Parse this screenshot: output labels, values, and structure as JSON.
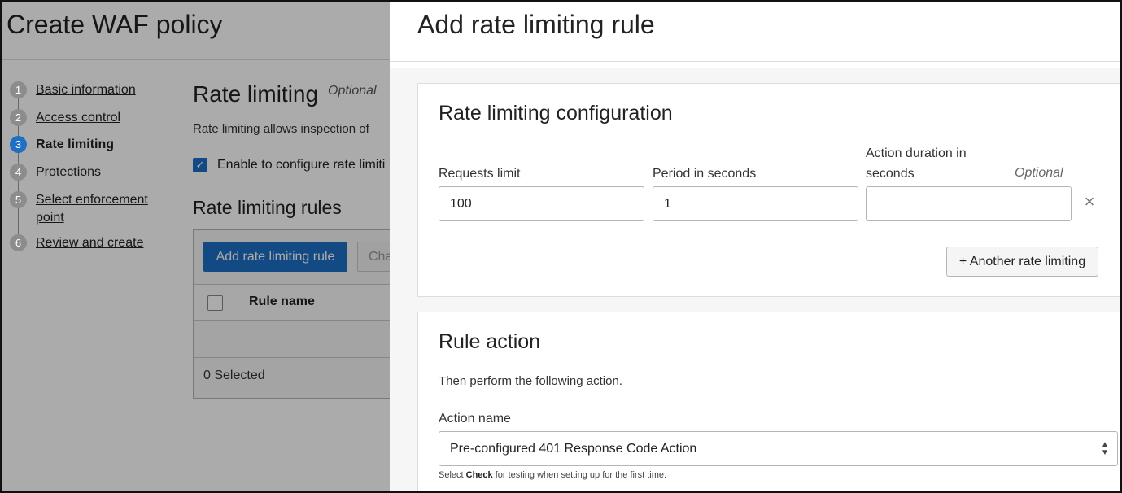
{
  "background_page": {
    "title": "Create WAF policy",
    "steps": [
      {
        "number": "1",
        "label": "Basic information",
        "active": false
      },
      {
        "number": "2",
        "label": "Access control",
        "active": false
      },
      {
        "number": "3",
        "label": "Rate limiting",
        "active": true
      },
      {
        "number": "4",
        "label": "Protections",
        "active": false
      },
      {
        "number": "5",
        "label": "Select enforcement",
        "label_line2": "point",
        "active": false
      },
      {
        "number": "6",
        "label": "Review and create",
        "active": false
      }
    ],
    "section": {
      "title": "Rate limiting",
      "optional_label": "Optional",
      "description": "Rate limiting allows inspection of",
      "enable_checkbox_label": "Enable to configure rate limiti",
      "enable_checked": true,
      "rules_title": "Rate limiting rules",
      "add_button_label": "Add rate limiting rule",
      "change_button_label": "Cha",
      "table": {
        "columns": [
          "Rule name"
        ],
        "selected_count_text": "0 Selected"
      }
    }
  },
  "panel": {
    "title": "Add rate limiting rule",
    "config_card": {
      "title": "Rate limiting configuration",
      "fields": {
        "requests_limit": {
          "label": "Requests limit",
          "value": "100"
        },
        "period": {
          "label": "Period in seconds",
          "value": "1"
        },
        "action_duration": {
          "label_line1": "Action duration in",
          "label_line2": "seconds",
          "optional_label": "Optional",
          "value": ""
        }
      },
      "another_button_label": "+ Another rate limiting"
    },
    "action_card": {
      "title": "Rule action",
      "description": "Then perform the following action.",
      "action_name_label": "Action name",
      "action_name_value": "Pre-configured 401 Response Code Action",
      "helper_prefix": "Select",
      "helper_bold": "Check",
      "helper_suffix": "for testing when setting up for the first time."
    }
  },
  "icons": {
    "close": "close-x-icon",
    "check": "check-icon",
    "chevron": "chevron-up-down-icon"
  },
  "colors": {
    "accent": "#1f6fc5",
    "step_inactive": "#8c8c8c"
  }
}
